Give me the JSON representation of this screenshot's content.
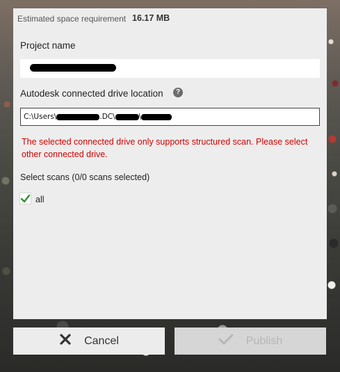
{
  "header": {
    "estimated_label": "Estimated space requirement",
    "estimated_value": "16.17 MB"
  },
  "project_name": {
    "label": "Project name",
    "value": ""
  },
  "drive_location": {
    "label": "Autodesk connected drive location",
    "help_icon": "?",
    "path_segments": [
      "C:\\Users\\",
      ".DC\\",
      "\\"
    ]
  },
  "error": {
    "message": "The selected connected drive only supports structured scan. Please select other connected drive."
  },
  "scans": {
    "label": "Select scans (0/0 scans selected)",
    "all_label": "all",
    "all_checked": true
  },
  "buttons": {
    "cancel_label": "Cancel",
    "cancel_icon": "close-icon",
    "publish_label": "Publish",
    "publish_icon": "checkmark-icon",
    "publish_enabled": false
  },
  "colors": {
    "panel_bg": "#ededed",
    "error_red": "#d40000",
    "check_green": "#2f8f2f",
    "disabled_text": "#b6b6b6"
  }
}
